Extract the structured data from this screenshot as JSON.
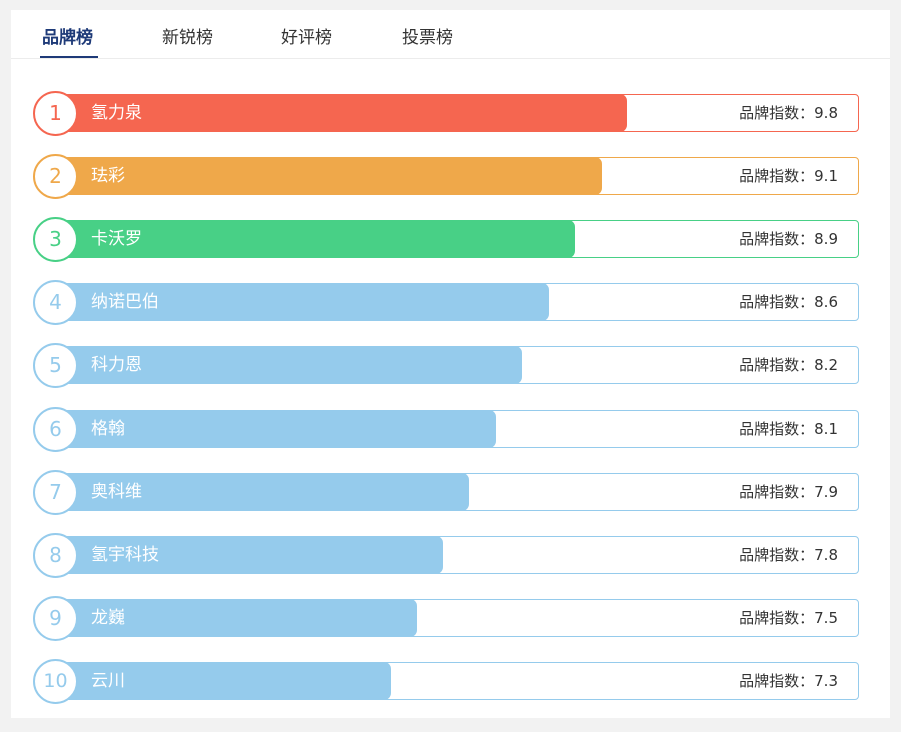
{
  "tabs": [
    {
      "label": "品牌榜",
      "active": true
    },
    {
      "label": "新锐榜",
      "active": false
    },
    {
      "label": "好评榜",
      "active": false
    },
    {
      "label": "投票榜",
      "active": false
    }
  ],
  "colors": {
    "active_tab": "#1e3a78",
    "rank1": "#f56650",
    "rank2": "#efa84a",
    "rank3": "#48d086",
    "rank_default": "#95cbec"
  },
  "ranking": {
    "score_label": "品牌指数：",
    "items": [
      {
        "rank": "1",
        "name": "氢力泉",
        "score": "9.8",
        "fill_fraction": 0.711
      },
      {
        "rank": "2",
        "name": "珐彩",
        "score": "9.1",
        "fill_fraction": 0.679
      },
      {
        "rank": "3",
        "name": "卡沃罗",
        "score": "8.9",
        "fill_fraction": 0.646
      },
      {
        "rank": "4",
        "name": "纳诺巴伯",
        "score": "8.6",
        "fill_fraction": 0.613
      },
      {
        "rank": "5",
        "name": "科力恩",
        "score": "8.2",
        "fill_fraction": 0.58
      },
      {
        "rank": "6",
        "name": "格翰",
        "score": "8.1",
        "fill_fraction": 0.547
      },
      {
        "rank": "7",
        "name": "奥科维",
        "score": "7.9",
        "fill_fraction": 0.514
      },
      {
        "rank": "8",
        "name": "氢宇科技",
        "score": "7.8",
        "fill_fraction": 0.481
      },
      {
        "rank": "9",
        "name": "龙巍",
        "score": "7.5",
        "fill_fraction": 0.449
      },
      {
        "rank": "10",
        "name": "云川",
        "score": "7.3",
        "fill_fraction": 0.416
      }
    ]
  }
}
